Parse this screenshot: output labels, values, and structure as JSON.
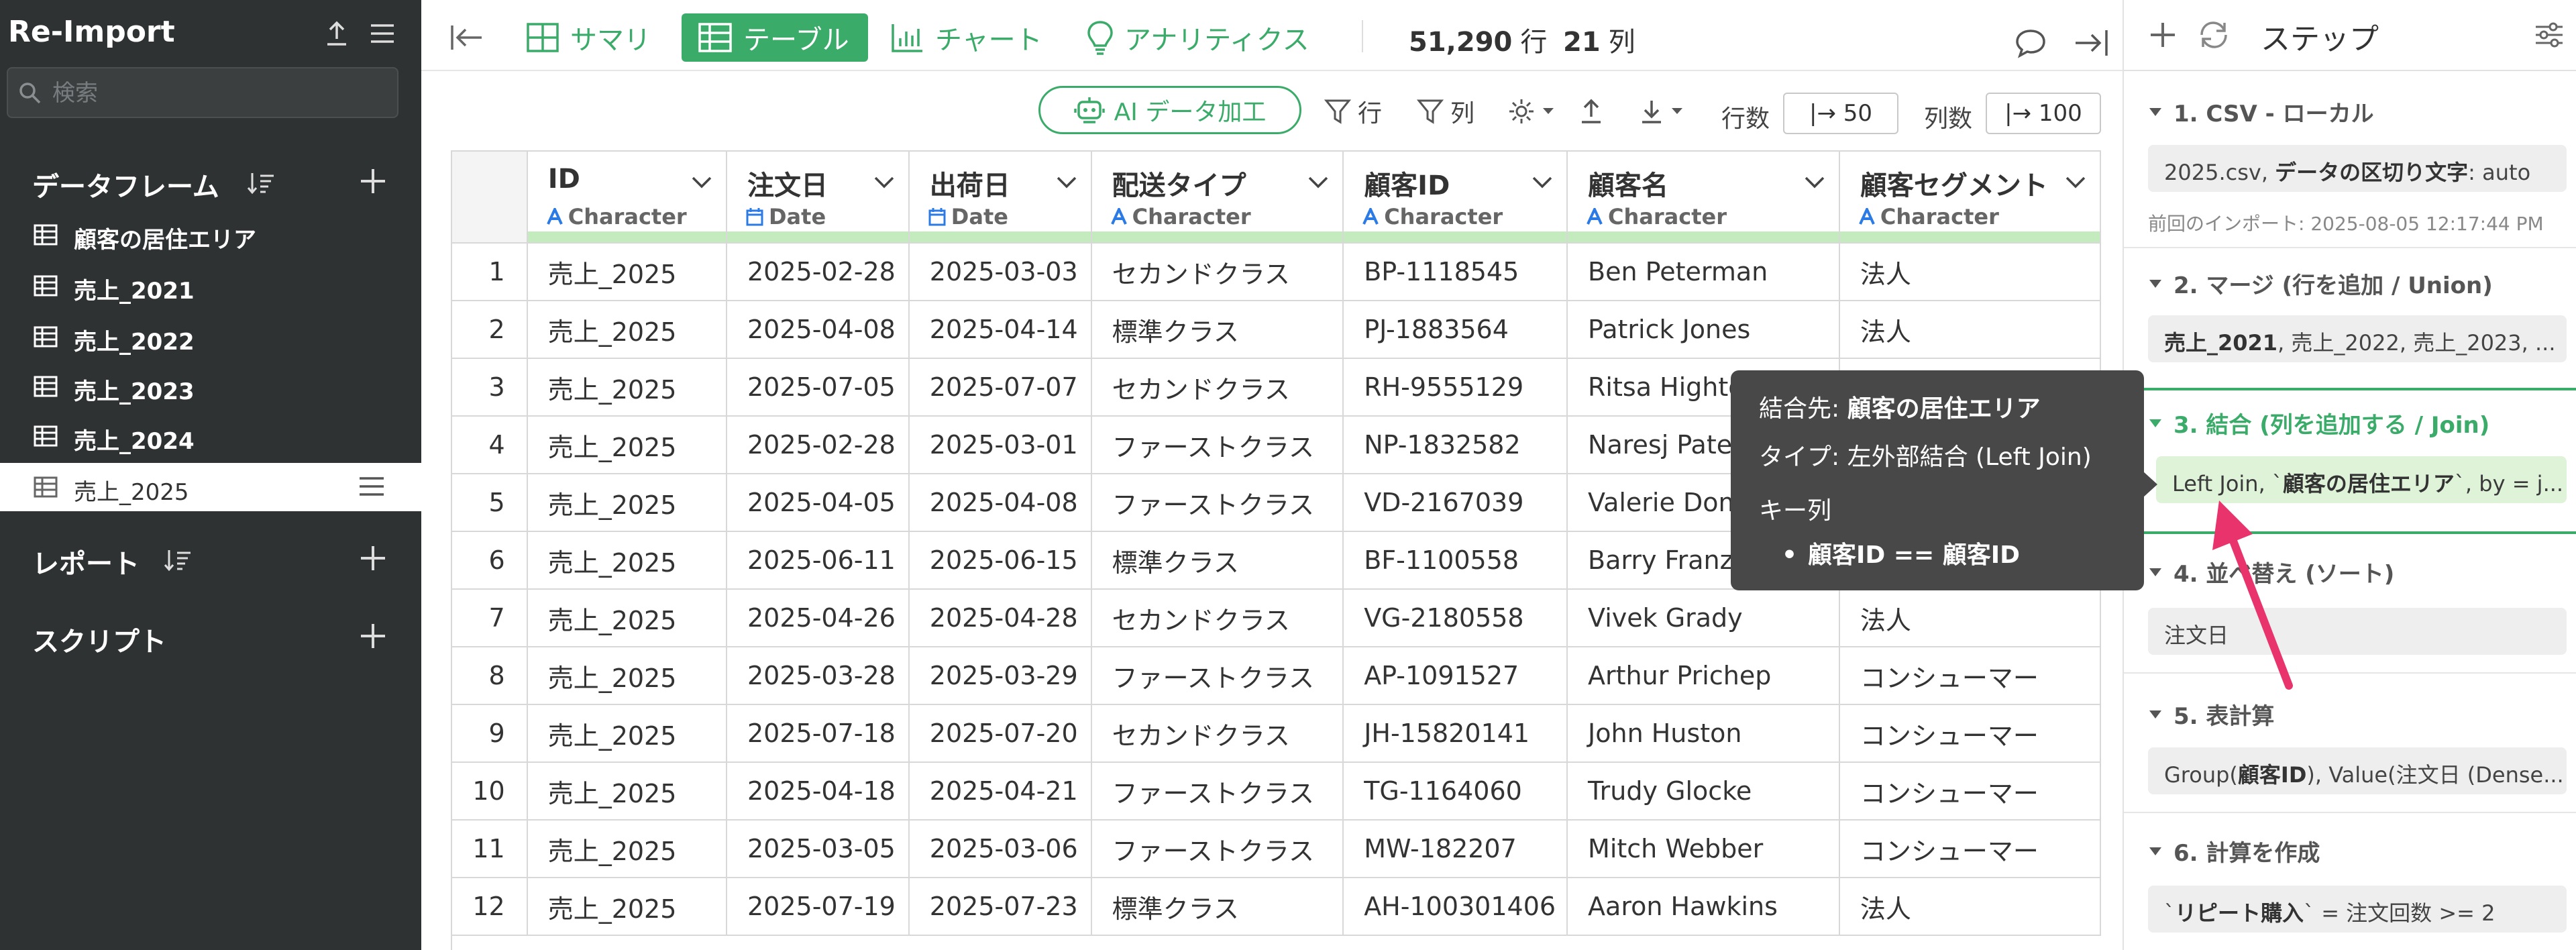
{
  "sidebar": {
    "title": "Re-Import",
    "search_placeholder": "検索",
    "dataframes_label": "データフレーム",
    "items": [
      {
        "label": "顧客の居住エリア"
      },
      {
        "label": "売上_2021"
      },
      {
        "label": "売上_2022"
      },
      {
        "label": "売上_2023"
      },
      {
        "label": "売上_2024"
      },
      {
        "label": "売上_2025"
      }
    ],
    "reports_label": "レポート",
    "scripts_label": "スクリプト"
  },
  "toolbar": {
    "summary_label": "サマリ",
    "table_label": "テーブル",
    "chart_label": "チャート",
    "analytics_label": "アナリティクス",
    "rows_count": "51,290",
    "rows_unit": "行",
    "cols_count": "21",
    "cols_unit": "列"
  },
  "subbar": {
    "ai_label": "AI データ加工",
    "row_filter_label": "行",
    "col_filter_label": "列",
    "rows_label": "行数",
    "rows_value": "|→ 50",
    "cols_label": "列数",
    "cols_value": "|→ 100"
  },
  "table": {
    "columns": [
      {
        "name": "ID",
        "type": "Character"
      },
      {
        "name": "注文日",
        "type": "Date"
      },
      {
        "name": "出荷日",
        "type": "Date"
      },
      {
        "name": "配送タイプ",
        "type": "Character"
      },
      {
        "name": "顧客ID",
        "type": "Character"
      },
      {
        "name": "顧客名",
        "type": "Character"
      },
      {
        "name": "顧客セグメント",
        "type": "Character"
      }
    ],
    "rows": [
      [
        "1",
        "売上_2025",
        "2025-02-28",
        "2025-03-03",
        "セカンドクラス",
        "BP-1118545",
        "Ben Peterman",
        "法人"
      ],
      [
        "2",
        "売上_2025",
        "2025-04-08",
        "2025-04-14",
        "標準クラス",
        "PJ-1883564",
        "Patrick Jones",
        "法人"
      ],
      [
        "3",
        "売上_2025",
        "2025-07-05",
        "2025-07-07",
        "セカンドクラス",
        "RH-9555129",
        "Ritsa Hightower",
        ""
      ],
      [
        "4",
        "売上_2025",
        "2025-02-28",
        "2025-03-01",
        "ファーストクラス",
        "NP-1832582",
        "Naresj Patel",
        ""
      ],
      [
        "5",
        "売上_2025",
        "2025-04-05",
        "2025-04-08",
        "ファーストクラス",
        "VD-2167039",
        "Valerie Dominguez",
        ""
      ],
      [
        "6",
        "売上_2025",
        "2025-06-11",
        "2025-06-15",
        "標準クラス",
        "BF-1100558",
        "Barry Franz",
        ""
      ],
      [
        "7",
        "売上_2025",
        "2025-04-26",
        "2025-04-28",
        "セカンドクラス",
        "VG-2180558",
        "Vivek Grady",
        "法人"
      ],
      [
        "8",
        "売上_2025",
        "2025-03-28",
        "2025-03-29",
        "ファーストクラス",
        "AP-1091527",
        "Arthur Prichep",
        "コンシューマー"
      ],
      [
        "9",
        "売上_2025",
        "2025-07-18",
        "2025-07-20",
        "セカンドクラス",
        "JH-15820141",
        "John Huston",
        "コンシューマー"
      ],
      [
        "10",
        "売上_2025",
        "2025-04-18",
        "2025-04-21",
        "ファーストクラス",
        "TG-1164060",
        "Trudy Glocke",
        "コンシューマー"
      ],
      [
        "11",
        "売上_2025",
        "2025-03-05",
        "2025-03-06",
        "ファーストクラス",
        "MW-182207",
        "Mitch Webber",
        "コンシューマー"
      ],
      [
        "12",
        "売上_2025",
        "2025-07-19",
        "2025-07-23",
        "標準クラス",
        "AH-100301406",
        "Aaron Hawkins",
        "法人"
      ]
    ]
  },
  "steps": {
    "title": "ステップ",
    "items": [
      {
        "head": "1. CSV - ローカル",
        "body_pre": "2025.csv, ",
        "body_bold": "データの区切り文字",
        "body_post": ": auto",
        "sub": "前回のインポート: 2025-08-05 12:17:44 PM"
      },
      {
        "head": "2. マージ (行を追加 / Union)",
        "body_pre": "",
        "body_bold": "売上_2021",
        "body_post": ", 売上_2022, 売上_2023, ..."
      },
      {
        "head": "3. 結合 (列を追加する / Join)",
        "body_pre": "Left Join, `",
        "body_bold": "顧客の居住エリア",
        "body_post": "`, by = j..."
      },
      {
        "head": "4. 並べ替え (ソート)",
        "body_pre": "注文日",
        "body_bold": "",
        "body_post": ""
      },
      {
        "head": "5. 表計算",
        "body_pre": "Group(",
        "body_bold": "顧客ID",
        "body_post": "), Value(注文日 (Dense..."
      },
      {
        "head": "6. 計算を作成",
        "body_pre": "`",
        "body_bold": "リピート購入",
        "body_post": "` = 注文回数 >= 2"
      }
    ]
  },
  "tooltip": {
    "target_label": "結合先: ",
    "target_value": "顧客の居住エリア",
    "type_label": "タイプ: ",
    "type_value": "左外部結合 (Left Join)",
    "key_label": "キー列",
    "key_value": "顧客ID == 顧客ID"
  },
  "colors": {
    "accent": "#3bab6a",
    "sidebar_bg": "#2f3233",
    "tooltip_bg": "#484848",
    "arrow": "#e8336d",
    "column_bar": "#c3ebbd"
  }
}
